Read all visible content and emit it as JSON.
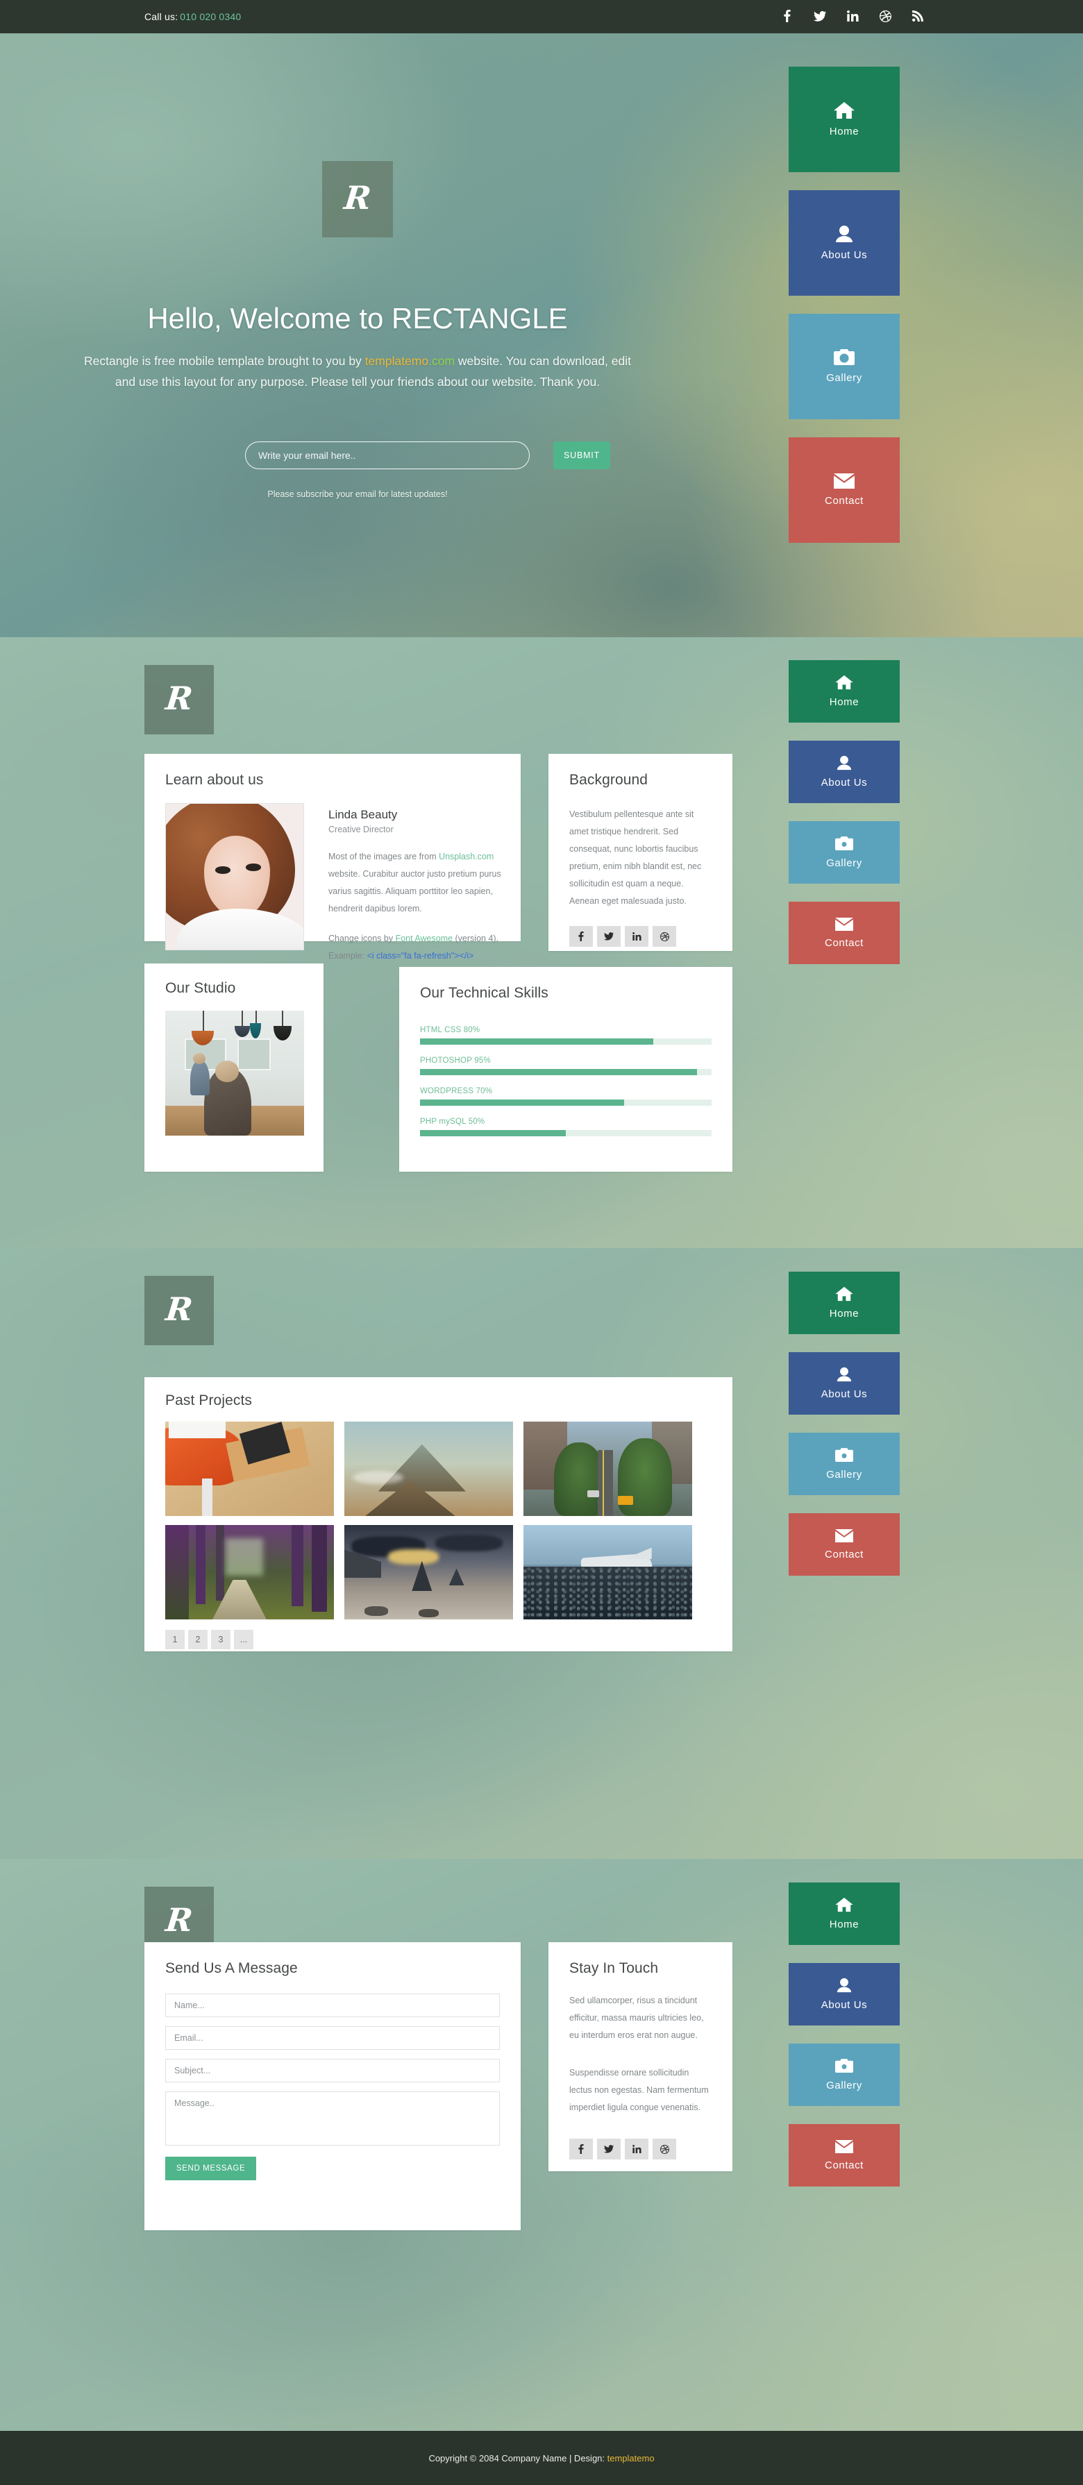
{
  "topbar": {
    "call_label": "Call us:",
    "phone": "010 020 0340",
    "social": [
      {
        "name": "facebook-icon",
        "label": "Facebook"
      },
      {
        "name": "twitter-icon",
        "label": "Twitter"
      },
      {
        "name": "linkedin-icon",
        "label": "LinkedIn"
      },
      {
        "name": "dribbble-icon",
        "label": "Dribbble"
      },
      {
        "name": "rss-icon",
        "label": "RSS"
      }
    ]
  },
  "brand": {
    "logo_glyph": "R",
    "name": "RECTANGLE"
  },
  "nav": {
    "items": [
      {
        "label": "Home",
        "icon": "home-icon",
        "color": "#1b8058"
      },
      {
        "label": "About Us",
        "icon": "user-icon",
        "color": "#3a5a93"
      },
      {
        "label": "Gallery",
        "icon": "camera-icon",
        "color": "#5ba3bc"
      },
      {
        "label": "Contact",
        "icon": "envelope-icon",
        "color": "#c45a52"
      }
    ]
  },
  "hero": {
    "title": "Hello, Welcome to RECTANGLE",
    "desc_1": "Rectangle is free mobile template brought to you by ",
    "desc_link_a": "templatemo",
    "desc_link_b": ".com",
    "desc_2": " website. You can download, edit and use this layout for any purpose. Please tell your friends about our website. Thank you.",
    "email_placeholder": "Write your email here..",
    "email_value": "",
    "submit_label": "SUBMIT",
    "note": "Please subscribe your email for latest updates!"
  },
  "about": {
    "learn_title": "Learn about us",
    "person_name": "Linda Beauty",
    "person_role": "Creative Director",
    "para_a_1": "Most of the images are from ",
    "para_a_link": "Unsplash.com",
    "para_a_2": " website. Curabitur auctor justo pretium purus varius sagittis. Aliquam porttitor leo sapien, hendrerit dapibus lorem.",
    "para_b_1": "Change icons by ",
    "para_b_link": "Font Awesome",
    "para_b_2": " (version 4). Example: ",
    "para_b_code": "<i class=\"fa fa-refresh\"></i>",
    "background_title": "Background",
    "background_text": "Vestibulum pellentesque ante sit amet tristique hendrerit. Sed consequat, nunc lobortis faucibus pretium, enim nibh blandit est, nec sollicitudin est quam a neque. Aenean eget malesuada justo.",
    "studio_title": "Our Studio",
    "skills_title": "Our Technical Skills",
    "social": [
      {
        "name": "facebook-icon"
      },
      {
        "name": "twitter-icon"
      },
      {
        "name": "linkedin-icon"
      },
      {
        "name": "dribbble-icon"
      }
    ]
  },
  "chart_data": {
    "type": "bar",
    "title": "Our Technical Skills",
    "categories": [
      "HTML CSS",
      "PHOTOSHOP",
      "WORDPRESS",
      "PHP mySQL"
    ],
    "values": [
      80,
      95,
      70,
      50
    ],
    "labels": [
      "HTML CSS 80%",
      "PHOTOSHOP 95%",
      "WORDPRESS 70%",
      "PHP mySQL 50%"
    ],
    "xlabel": "",
    "ylabel": "",
    "ylim": [
      0,
      100
    ],
    "orientation": "horizontal",
    "grid": false,
    "legend": "none",
    "bar_color": "#5bb48e",
    "track_color": "#e4f0ea"
  },
  "gallery": {
    "title": "Past Projects",
    "items": [
      {
        "alt": "orange chair and wooden desk"
      },
      {
        "alt": "volcano mountain landscape"
      },
      {
        "alt": "tree lined city street with taxi"
      },
      {
        "alt": "forest path with purple tint"
      },
      {
        "alt": "rocky beach at sunset"
      },
      {
        "alt": "plane wreck on black sand"
      }
    ],
    "pager": [
      "1",
      "2",
      "3",
      "..."
    ]
  },
  "contact": {
    "form_title": "Send Us A Message",
    "name_placeholder": "Name...",
    "name_value": "",
    "email_placeholder": "Email...",
    "email_value": "",
    "subject_placeholder": "Subject...",
    "subject_value": "",
    "message_placeholder": "Message..",
    "message_value": "",
    "send_label": "SEND MESSAGE",
    "touch_title": "Stay In Touch",
    "touch_p1": "Sed ullamcorper, risus a tincidunt efficitur, massa mauris ultricies leo, eu interdum eros erat non augue.",
    "touch_p2": "Suspendisse ornare sollicitudin lectus non egestas. Nam fermentum imperdiet ligula congue venenatis.",
    "social": [
      {
        "name": "facebook-icon"
      },
      {
        "name": "twitter-icon"
      },
      {
        "name": "linkedin-icon"
      },
      {
        "name": "dribbble-icon"
      }
    ]
  },
  "footer": {
    "copyright": "Copyright © 2084 Company Name | Design: ",
    "link_a": "templatemo",
    "link_b": ""
  },
  "colors": {
    "accent_green": "#4fb58b",
    "nav_home": "#1b8058",
    "nav_about": "#3a5a93",
    "nav_gallery": "#5ba3bc",
    "nav_contact": "#c45a52",
    "dark_bar": "#2d3730",
    "footer_bar": "#2a332c"
  }
}
